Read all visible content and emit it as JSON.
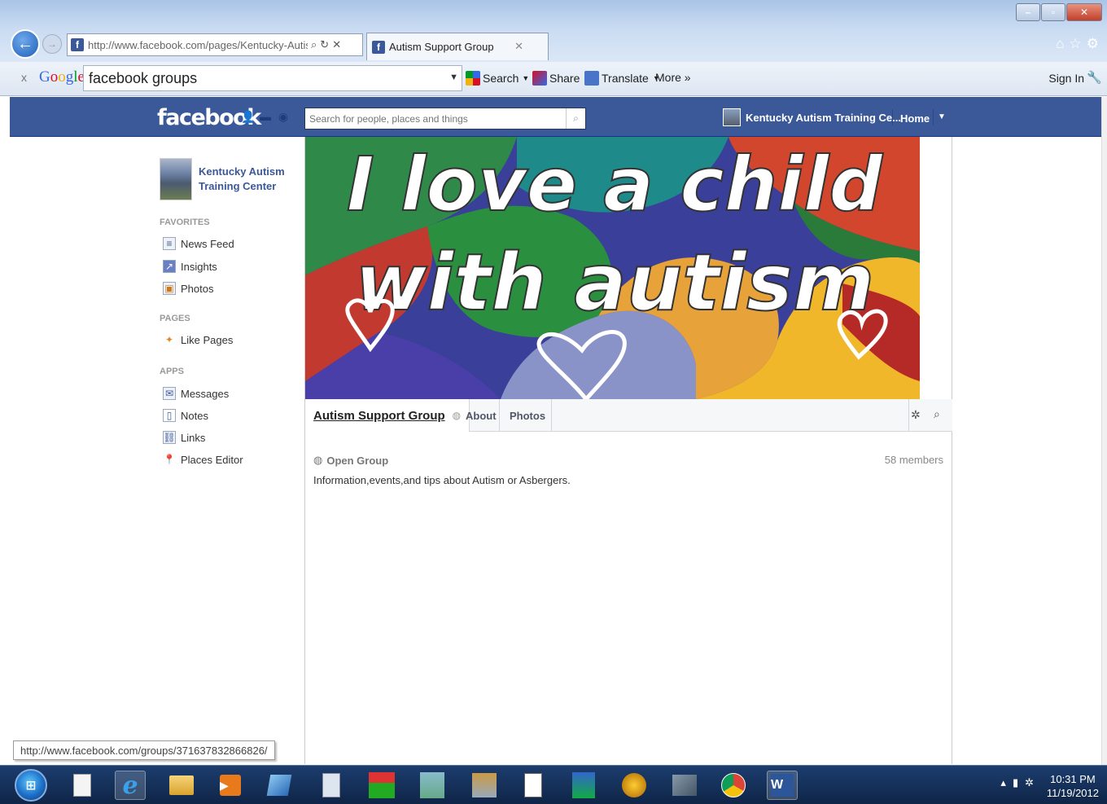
{
  "browser": {
    "url": "http://www.facebook.com/pages/Kentucky-Autism",
    "tab_title": "Autism Support Group",
    "favicon_letter": "f",
    "status_url": "http://www.facebook.com/groups/371637832866826/"
  },
  "google_toolbar": {
    "close_glyph": "x",
    "logo": "Google",
    "search_value": "facebook groups",
    "search_label": "Search",
    "share_label": "Share",
    "translate_label": "Translate",
    "more_label": "More »",
    "signin_label": "Sign In"
  },
  "fb_header": {
    "logo": "facebook",
    "search_placeholder": "Search for people, places and things",
    "profile_name": "Kentucky Autism Training Ce...",
    "home_label": "Home"
  },
  "sidebar": {
    "page_name": "Kentucky Autism Training Center",
    "sections": [
      {
        "title": "FAVORITES",
        "items": [
          {
            "label": "News Feed",
            "icon": "news-feed-icon"
          },
          {
            "label": "Insights",
            "icon": "insights-icon"
          },
          {
            "label": "Photos",
            "icon": "photos-icon"
          }
        ]
      },
      {
        "title": "PAGES",
        "items": [
          {
            "label": "Like Pages",
            "icon": "like-pages-icon"
          }
        ]
      },
      {
        "title": "APPS",
        "items": [
          {
            "label": "Messages",
            "icon": "messages-icon"
          },
          {
            "label": "Notes",
            "icon": "notes-icon"
          },
          {
            "label": "Links",
            "icon": "links-icon"
          },
          {
            "label": "Places Editor",
            "icon": "places-editor-icon"
          }
        ]
      }
    ]
  },
  "group": {
    "cover_text_line1": "I love a child",
    "cover_text_line2": "with autism",
    "name": "Autism Support Group",
    "tabs": [
      "About",
      "Photos"
    ],
    "privacy": "Open Group",
    "members": "58 members",
    "description": "Information,events,and tips about Autism or Asbergers."
  },
  "taskbar": {
    "time": "10:31 PM",
    "date": "11/19/2012",
    "word_label": "W"
  },
  "colors": {
    "facebook_blue": "#3b5998",
    "taskbar": "#0f2547"
  }
}
